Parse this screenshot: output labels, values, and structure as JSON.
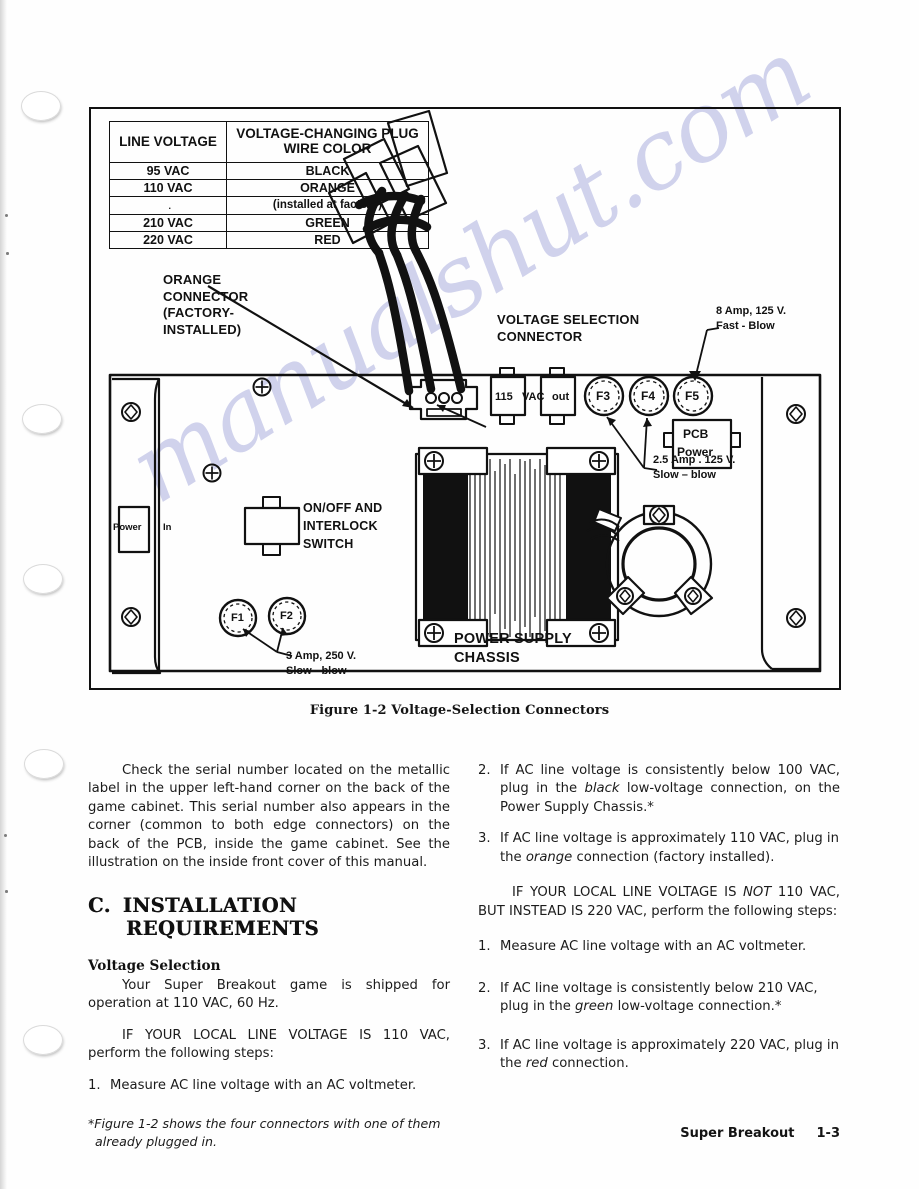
{
  "figure": {
    "caption": "Figure 1-2  Voltage-Selection Connectors",
    "table": {
      "headers": [
        "LINE\nVOLTAGE",
        "VOLTAGE-CHANGING\nPLUG WIRE COLOR"
      ],
      "rows": [
        {
          "voltage": "95 VAC",
          "color": "BLACK",
          "note": ""
        },
        {
          "voltage": "110 VAC",
          "color": "ORANGE",
          "note": "(installed at factory)"
        },
        {
          "voltage": "210 VAC",
          "color": "GREEN",
          "note": ""
        },
        {
          "voltage": "220 VAC",
          "color": "RED",
          "note": ""
        }
      ]
    },
    "callouts": {
      "orange_connector": "ORANGE\nCONNECTOR\n(FACTORY-\nINSTALLED)",
      "voltage_selection_connector": "VOLTAGE SELECTION\nCONNECTOR",
      "fuse_f5": "8 Amp,  125 V.\nFast - Blow",
      "fuse_f3_f4": "2.5 Amp . 125 V.\nSlow – blow",
      "fuse_f1_f2": "3 Amp, 250 V.\nSlow - blow",
      "switch": "ON/OFF AND\nINTERLOCK\nSWITCH",
      "power_supply_chassis": "POWER SUPPLY\nCHASSIS"
    },
    "parts": {
      "power_in": "Power",
      "power_in_2": "In",
      "outlet_115": "115",
      "outlet_vac": "VAC",
      "outlet_out": "out",
      "fuse_f1": "F1",
      "fuse_f2": "F2",
      "fuse_f3": "F3",
      "fuse_f4": "F4",
      "fuse_f5": "F5",
      "pcb_power_line1": "PCB",
      "pcb_power_line2": "Power"
    }
  },
  "body": {
    "left": {
      "para_serial": "Check the serial number located on the metallic label in the upper left-hand corner on the back of the game cabinet. This serial number also appears in the corner (common to both edge connectors) on the back of the PCB, inside the game cabinet. See the illustration on the inside front cover of this manual.",
      "section_letter": "C.",
      "section_title_line1": "INSTALLATION",
      "section_title_line2": "REQUIREMENTS",
      "subhead_voltage_selection": "Voltage Selection",
      "para_shipped": "Your Super Breakout game is shipped for operation at 110 VAC, 60 Hz.",
      "para_if_110_a": "IF YOUR LOCAL LINE VOLTAGE IS 110 VAC, perform the following steps:",
      "step1_num": "1.",
      "step1_text": "Measure AC line voltage with an AC voltmeter.",
      "footnote": "*Figure 1-2 shows the four connectors with one of them already plugged in."
    },
    "right": {
      "step2_num": "2.",
      "step2_a": "If AC line voltage is consistently below 100 VAC, plug in the ",
      "step2_em": "black",
      "step2_b": " low-voltage connection, on the Power Supply Chassis.*",
      "step3_num": "3.",
      "step3_a": "If AC line voltage is approximately 110 VAC, plug in the ",
      "step3_em": "orange",
      "step3_b": " connection (factory installed).",
      "para_not110_a": "IF YOUR LOCAL LINE VOLTAGE IS ",
      "para_not110_em": "NOT",
      "para_not110_b": " 110 VAC, BUT INSTEAD IS 220 VAC, perform the following steps:",
      "step1b_num": "1.",
      "step1b_text": "Measure AC line voltage with an AC voltmeter.",
      "step2b_num": "2.",
      "step2b_a": "If AC line voltage is consistently below 210 VAC, plug in the ",
      "step2b_em": "green",
      "step2b_b": " low-voltage connection.*",
      "step3b_num": "3.",
      "step3b_a": "If AC line voltage is approximately 220 VAC, plug in the ",
      "step3b_em": "red",
      "step3b_b": " connection."
    }
  },
  "footer": {
    "game_title": "Super Breakout",
    "page_number": "1-3"
  },
  "watermark": {
    "text": "manualshut.com"
  },
  "colors": {
    "ink": "#1a1a1a",
    "watermark": "#686cc4"
  }
}
